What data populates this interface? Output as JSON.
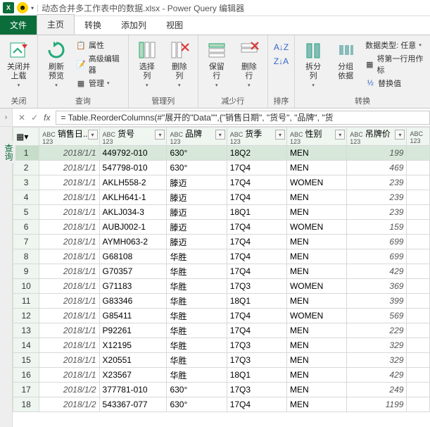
{
  "titlebar": {
    "title": "动态合并多工作表中的数据.xlsx - Power Query 编辑器"
  },
  "tabs": {
    "file": "文件",
    "items": [
      "主页",
      "转换",
      "添加列",
      "视图"
    ],
    "active": 0
  },
  "ribbon": {
    "groups": {
      "close": {
        "label": "关闭",
        "btn": "关闭并\n上载",
        "arrow": "▾"
      },
      "query": {
        "label": "查询",
        "refresh": "刷新\n预览",
        "props": "属性",
        "advanced": "高级编辑器",
        "manage": "管理"
      },
      "cols": {
        "label": "管理列",
        "choose": "选择\n列",
        "remove": "删除\n列"
      },
      "rows": {
        "label": "减少行",
        "keep": "保留\n行",
        "remove": "删除\n行"
      },
      "sort": {
        "label": "排序"
      },
      "transform": {
        "label": "转换",
        "split": "拆分\n列",
        "group": "分组\n依据",
        "dtype": "数据类型: 任意",
        "header": "将第一行用作标",
        "replace": "替换值"
      }
    }
  },
  "formula": {
    "fx": "fx",
    "text": "= Table.ReorderColumns(#\"展开的\"Data\"\",{\"销售日期\", \"货号\", \"品牌\", \"货"
  },
  "sidebar": {
    "label": "查询"
  },
  "columns": [
    "销售日...",
    "货号",
    "品牌",
    "货季",
    "性别",
    "吊牌价"
  ],
  "rows": [
    {
      "n": 1,
      "d": "2018/1/1",
      "c": "449792-010",
      "b": "630°",
      "s": "18Q2",
      "g": "MEN",
      "p": 199
    },
    {
      "n": 2,
      "d": "2018/1/1",
      "c": "547798-010",
      "b": "630°",
      "s": "17Q4",
      "g": "MEN",
      "p": 469
    },
    {
      "n": 3,
      "d": "2018/1/1",
      "c": "AKLH558-2",
      "b": "滕迈",
      "s": "17Q4",
      "g": "WOMEN",
      "p": 239
    },
    {
      "n": 4,
      "d": "2018/1/1",
      "c": "AKLH641-1",
      "b": "滕迈",
      "s": "17Q4",
      "g": "MEN",
      "p": 239
    },
    {
      "n": 5,
      "d": "2018/1/1",
      "c": "AKLJ034-3",
      "b": "滕迈",
      "s": "18Q1",
      "g": "MEN",
      "p": 239
    },
    {
      "n": 6,
      "d": "2018/1/1",
      "c": "AUBJ002-1",
      "b": "滕迈",
      "s": "17Q4",
      "g": "WOMEN",
      "p": 159
    },
    {
      "n": 7,
      "d": "2018/1/1",
      "c": "AYMH063-2",
      "b": "滕迈",
      "s": "17Q4",
      "g": "MEN",
      "p": 699
    },
    {
      "n": 8,
      "d": "2018/1/1",
      "c": "G68108",
      "b": "华胜",
      "s": "17Q4",
      "g": "MEN",
      "p": 699
    },
    {
      "n": 9,
      "d": "2018/1/1",
      "c": "G70357",
      "b": "华胜",
      "s": "17Q4",
      "g": "MEN",
      "p": 429
    },
    {
      "n": 10,
      "d": "2018/1/1",
      "c": "G71183",
      "b": "华胜",
      "s": "17Q3",
      "g": "WOMEN",
      "p": 369
    },
    {
      "n": 11,
      "d": "2018/1/1",
      "c": "G83346",
      "b": "华胜",
      "s": "18Q1",
      "g": "MEN",
      "p": 399
    },
    {
      "n": 12,
      "d": "2018/1/1",
      "c": "G85411",
      "b": "华胜",
      "s": "17Q4",
      "g": "WOMEN",
      "p": 569
    },
    {
      "n": 13,
      "d": "2018/1/1",
      "c": "P92261",
      "b": "华胜",
      "s": "17Q4",
      "g": "MEN",
      "p": 229
    },
    {
      "n": 14,
      "d": "2018/1/1",
      "c": "X12195",
      "b": "华胜",
      "s": "17Q3",
      "g": "MEN",
      "p": 329
    },
    {
      "n": 15,
      "d": "2018/1/1",
      "c": "X20551",
      "b": "华胜",
      "s": "17Q3",
      "g": "MEN",
      "p": 329
    },
    {
      "n": 16,
      "d": "2018/1/1",
      "c": "X23567",
      "b": "华胜",
      "s": "18Q1",
      "g": "MEN",
      "p": 429
    },
    {
      "n": 17,
      "d": "2018/1/2",
      "c": "377781-010",
      "b": "630°",
      "s": "17Q3",
      "g": "MEN",
      "p": 249
    },
    {
      "n": 18,
      "d": "2018/1/2",
      "c": "543367-077",
      "b": "630°",
      "s": "17Q4",
      "g": "MEN",
      "p": 1199
    }
  ]
}
